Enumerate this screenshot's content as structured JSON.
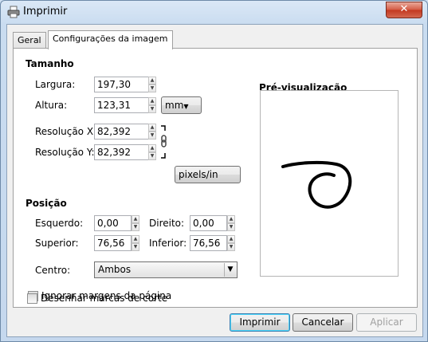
{
  "window": {
    "title": "Imprimir",
    "close_symbol": "✕"
  },
  "tabs": [
    {
      "label": "Geral"
    },
    {
      "label": "Configurações da imagem"
    }
  ],
  "size": {
    "heading": "Tamanho",
    "width_label": "Largura:",
    "width_value": "197,30",
    "height_label": "Altura:",
    "height_value": "123,31",
    "unit": "mm",
    "resx_label": "Resolução X:",
    "resx_value": "82,392",
    "resy_label": "Resolução Y:",
    "resy_value": "82,392",
    "res_unit": "pixels/in"
  },
  "position": {
    "heading": "Posição",
    "left_label": "Esquerdo:",
    "left_value": "0,00",
    "right_label": "Direito:",
    "right_value": "0,00",
    "top_label": "Superior:",
    "top_value": "76,56",
    "bottom_label": "Inferior:",
    "bottom_value": "76,56",
    "center_label": "Centro:",
    "center_value": "Ambos"
  },
  "options": {
    "ignore_margins": "Ignorar margens da página",
    "crop_marks": "Desenhar marcas de corte"
  },
  "preview": {
    "heading": "Pré-visualização"
  },
  "buttons": {
    "print": "Imprimir",
    "cancel": "Cancelar",
    "apply": "Aplicar"
  }
}
